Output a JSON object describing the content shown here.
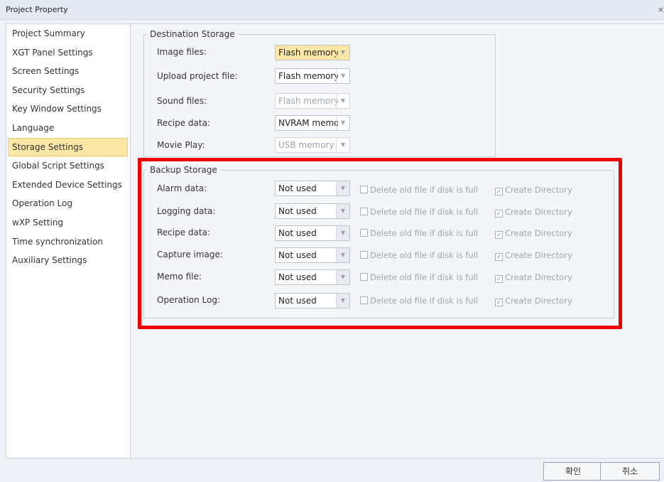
{
  "window": {
    "title": "Project Property",
    "close_icon": "×"
  },
  "sidebar": {
    "items": [
      {
        "label": "Project Summary",
        "active": false
      },
      {
        "label": "XGT Panel Settings",
        "active": false
      },
      {
        "label": "Screen Settings",
        "active": false
      },
      {
        "label": "Security Settings",
        "active": false
      },
      {
        "label": "Key Window Settings",
        "active": false
      },
      {
        "label": "Language",
        "active": false
      },
      {
        "label": "Storage Settings",
        "active": true
      },
      {
        "label": "Global Script Settings",
        "active": false
      },
      {
        "label": "Extended Device Settings",
        "active": false
      },
      {
        "label": "Operation Log",
        "active": false
      },
      {
        "label": "wXP Setting",
        "active": false
      },
      {
        "label": "Time synchronization",
        "active": false
      },
      {
        "label": "Auxiliary Settings",
        "active": false
      }
    ]
  },
  "destination": {
    "legend": "Destination Storage",
    "rows": [
      {
        "label": "Image files:",
        "value": "Flash memory",
        "state": "highlighted"
      },
      {
        "label": "Upload project file:",
        "value": "Flash memory",
        "state": "normal"
      },
      {
        "label": "Sound files:",
        "value": "Flash memory",
        "state": "disabled"
      },
      {
        "label": "Recipe data:",
        "value": "NVRAM memor",
        "state": "normal"
      },
      {
        "label": "Movie Play:",
        "value": "USB memory",
        "state": "disabled"
      }
    ]
  },
  "backup": {
    "legend": "Backup Storage",
    "delete_label": "Delete old file if disk is full",
    "create_label": "Create Directory",
    "rows": [
      {
        "label": "Alarm data:",
        "value": "Not used",
        "delete_checked": false,
        "create_checked": true
      },
      {
        "label": "Logging data:",
        "value": "Not used",
        "delete_checked": false,
        "create_checked": true
      },
      {
        "label": "Recipe data:",
        "value": "Not used",
        "delete_checked": false,
        "create_checked": true
      },
      {
        "label": "Capture image:",
        "value": "Not used",
        "delete_checked": false,
        "create_checked": true
      },
      {
        "label": "Memo file:",
        "value": "Not used",
        "delete_checked": false,
        "create_checked": true
      },
      {
        "label": "Operation Log:",
        "value": "Not used",
        "delete_checked": false,
        "create_checked": true
      }
    ]
  },
  "buttons": {
    "ok": "확인",
    "cancel": "취소"
  },
  "colors": {
    "highlight": "#fde7a6",
    "annotation": "#ee0000"
  }
}
